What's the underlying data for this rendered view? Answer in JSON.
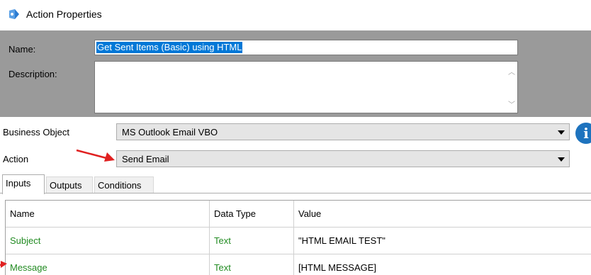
{
  "window": {
    "title": "Action Properties",
    "icon": "blue-prism-icon"
  },
  "form": {
    "name_label": "Name:",
    "name_value": "Get Sent Items (Basic) using HTML",
    "description_label": "Description:",
    "description_value": ""
  },
  "business_object": {
    "label": "Business Object",
    "value": "MS Outlook Email VBO"
  },
  "action": {
    "label": "Action",
    "value": "Send Email"
  },
  "tabs": [
    {
      "label": "Inputs",
      "active": true
    },
    {
      "label": "Outputs",
      "active": false
    },
    {
      "label": "Conditions",
      "active": false
    }
  ],
  "grid": {
    "headers": [
      "Name",
      "Data Type",
      "Value"
    ],
    "rows": [
      {
        "name": "Subject",
        "type": "Text",
        "value": "\"HTML EMAIL TEST\""
      },
      {
        "name": "Message",
        "type": "Text",
        "value": "[HTML MESSAGE]"
      }
    ]
  },
  "colors": {
    "selection": "#0078d7",
    "param_name": "#228b22",
    "annotation_arrow": "#e02020",
    "info_icon": "#1e73be"
  }
}
